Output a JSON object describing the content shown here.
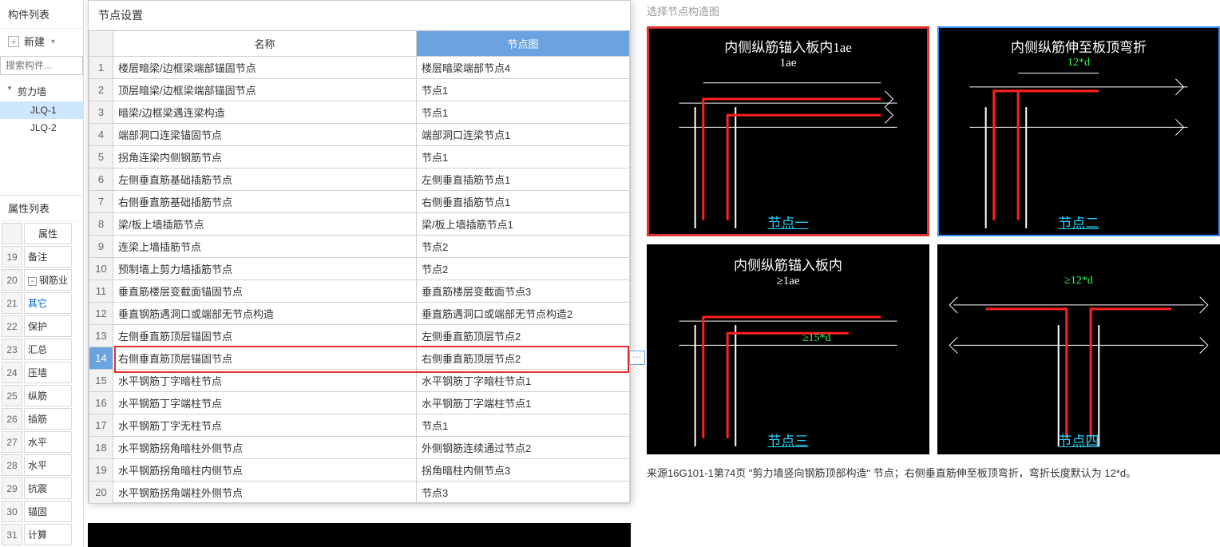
{
  "left": {
    "panel_title": "构件列表",
    "new_btn": "新建",
    "search_placeholder": "搜索构件...",
    "tree_parent": "剪力墙",
    "tree_items": [
      "JLQ-1",
      "JLQ-2"
    ],
    "selected_tree_idx": 0
  },
  "props": {
    "panel_title": "属性列表",
    "col_label": "属性",
    "rows": [
      {
        "n": "19",
        "name": "备注"
      },
      {
        "n": "20",
        "name": "钢筋业",
        "exp": "-"
      },
      {
        "n": "21",
        "name": "其它",
        "blue": true
      },
      {
        "n": "22",
        "name": "保护"
      },
      {
        "n": "23",
        "name": "汇总"
      },
      {
        "n": "24",
        "name": "压墙"
      },
      {
        "n": "25",
        "name": "纵筋"
      },
      {
        "n": "26",
        "name": "插筋"
      },
      {
        "n": "27",
        "name": "水平"
      },
      {
        "n": "28",
        "name": "水平"
      },
      {
        "n": "29",
        "name": "抗震"
      },
      {
        "n": "30",
        "name": "锚固"
      },
      {
        "n": "31",
        "name": "计算"
      }
    ]
  },
  "node_dialog": {
    "title": "节点设置",
    "col_name": "名称",
    "col_diagram": "节点图",
    "highlight_row": 14,
    "rows": [
      {
        "n": 1,
        "name": "楼层暗梁/边框梁端部锚固节点",
        "d": "楼层暗梁端部节点4"
      },
      {
        "n": 2,
        "name": "顶层暗梁/边框梁端部锚固节点",
        "d": "节点1"
      },
      {
        "n": 3,
        "name": "暗梁/边框梁遇连梁构造",
        "d": "节点1"
      },
      {
        "n": 4,
        "name": "端部洞口连梁锚固节点",
        "d": "端部洞口连梁节点1"
      },
      {
        "n": 5,
        "name": "拐角连梁内侧钢筋节点",
        "d": "节点1"
      },
      {
        "n": 6,
        "name": "左侧垂直筋基础插筋节点",
        "d": "左侧垂直插筋节点1"
      },
      {
        "n": 7,
        "name": "右侧垂直筋基础插筋节点",
        "d": "右侧垂直插筋节点1"
      },
      {
        "n": 8,
        "name": "梁/板上墙插筋节点",
        "d": "梁/板上墙插筋节点1"
      },
      {
        "n": 9,
        "name": "连梁上墙插筋节点",
        "d": "节点2"
      },
      {
        "n": 10,
        "name": "预制墙上剪力墙插筋节点",
        "d": "节点2"
      },
      {
        "n": 11,
        "name": "垂直筋楼层变截面锚固节点",
        "d": "垂直筋楼层变截面节点3"
      },
      {
        "n": 12,
        "name": "垂直钢筋遇洞口或端部无节点构造",
        "d": "垂直筋遇洞口或端部无节点构造2"
      },
      {
        "n": 13,
        "name": "左侧垂直筋顶层锚固节点",
        "d": "左侧垂直筋顶层节点2"
      },
      {
        "n": 14,
        "name": "右侧垂直筋顶层锚固节点",
        "d": "右侧垂直筋顶层节点2"
      },
      {
        "n": 15,
        "name": "水平钢筋丁字暗柱节点",
        "d": "水平钢筋丁字暗柱节点1"
      },
      {
        "n": 16,
        "name": "水平钢筋丁字端柱节点",
        "d": "水平钢筋丁字端柱节点1"
      },
      {
        "n": 17,
        "name": "水平钢筋丁字无柱节点",
        "d": "节点1"
      },
      {
        "n": 18,
        "name": "水平钢筋拐角暗柱外侧节点",
        "d": "外侧钢筋连续通过节点2"
      },
      {
        "n": 19,
        "name": "水平钢筋拐角暗柱内侧节点",
        "d": "拐角暗柱内侧节点3"
      },
      {
        "n": 20,
        "name": "水平钢筋拐角端柱外侧节点",
        "d": "节点3"
      }
    ]
  },
  "diagrams": {
    "panel_title": "选择节点构造图",
    "items": [
      {
        "title": "内侧纵筋锚入板内1ae",
        "sub": "1ae",
        "label": "节点一",
        "sel": "red"
      },
      {
        "title": "内侧纵筋伸至板顶弯折",
        "sub": "12*d",
        "subgreen": true,
        "label": "节点二",
        "sel": "blue"
      },
      {
        "title": "内侧纵筋锚入板内",
        "sub": "≥1ae",
        "extra": "≥15*d",
        "label": "节点三"
      },
      {
        "title": "",
        "sub": "≥12*d",
        "subgreen": true,
        "label": "节点四"
      }
    ],
    "source_text": "来源16G101-1第74页 \"剪力墙竖向钢筋顶部构造\" 节点；右侧垂直筋伸至板顶弯折，弯折长度默认为 12*d。"
  }
}
